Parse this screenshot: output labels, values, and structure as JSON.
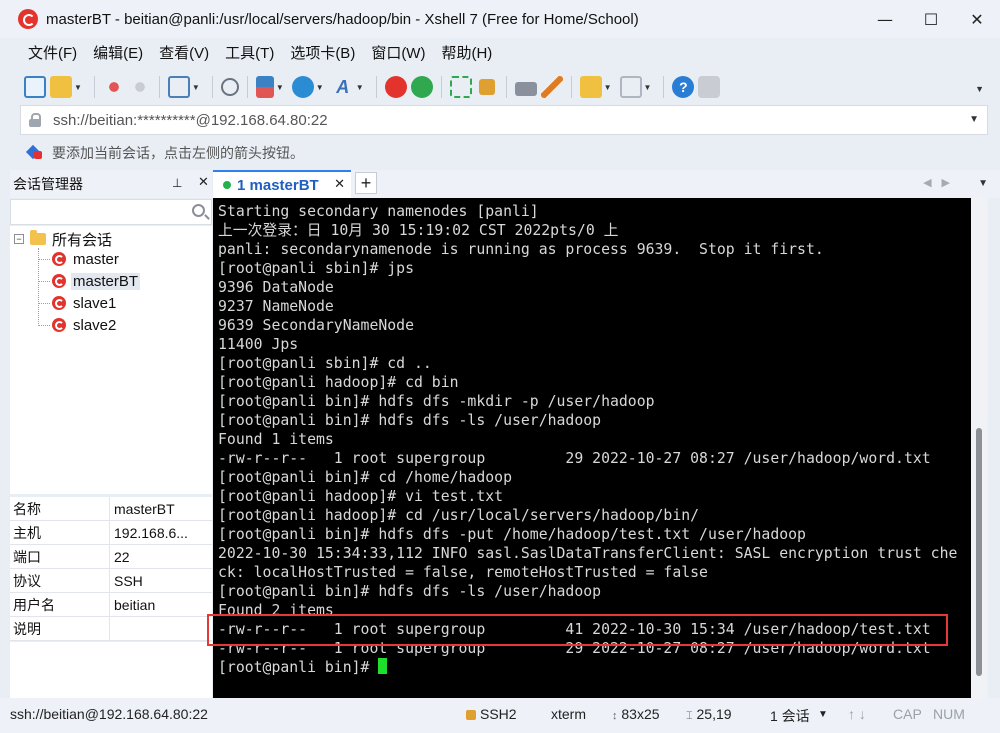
{
  "window": {
    "title": "masterBT - beitian@panli:/usr/local/servers/hadoop/bin - Xshell 7 (Free for Home/School)",
    "minimize": "—",
    "maximize": "☐",
    "close": "✕"
  },
  "menu": [
    "文件(F)",
    "编辑(E)",
    "查看(V)",
    "工具(T)",
    "选项卡(B)",
    "窗口(W)",
    "帮助(H)"
  ],
  "address": {
    "value": "ssh://beitian:**********@192.168.64.80:22"
  },
  "hint": {
    "text": "要添加当前会话，点击左侧的箭头按钮。"
  },
  "session_manager": {
    "title": "会话管理器",
    "pin": "⊥",
    "close": "✕",
    "root_label": "所有会话",
    "toggle": "−",
    "sessions": [
      "master",
      "masterBT",
      "slave1",
      "slave2"
    ],
    "selected": "masterBT"
  },
  "properties": [
    {
      "key": "名称",
      "value": "masterBT"
    },
    {
      "key": "主机",
      "value": "192.168.6..."
    },
    {
      "key": "端口",
      "value": "22"
    },
    {
      "key": "协议",
      "value": "SSH"
    },
    {
      "key": "用户名",
      "value": "beitian"
    },
    {
      "key": "说明",
      "value": ""
    }
  ],
  "tab": {
    "label": "1 masterBT",
    "close": "✕",
    "add": "+"
  },
  "terminal": {
    "lines": [
      "Starting secondary namenodes [panli]",
      "上一次登录：日 10月 30 15:19:02 CST 2022pts/0 上",
      "panli: secondarynamenode is running as process 9639.  Stop it first.",
      "[root@panli sbin]# jps",
      "9396 DataNode",
      "9237 NameNode",
      "9639 SecondaryNameNode",
      "11400 Jps",
      "[root@panli sbin]# cd ..",
      "[root@panli hadoop]# cd bin",
      "[root@panli bin]# hdfs dfs -mkdir -p /user/hadoop",
      "[root@panli bin]# hdfs dfs -ls /user/hadoop",
      "Found 1 items",
      "-rw-r--r--   1 root supergroup         29 2022-10-27 08:27 /user/hadoop/word.txt",
      "[root@panli bin]# cd /home/hadoop",
      "[root@panli hadoop]# vi test.txt",
      "[root@panli hadoop]# cd /usr/local/servers/hadoop/bin/",
      "[root@panli bin]# hdfs dfs -put /home/hadoop/test.txt /user/hadoop",
      "2022-10-30 15:34:33,112 INFO sasl.SaslDataTransferClient: SASL encryption trust che",
      "ck: localHostTrusted = false, remoteHostTrusted = false",
      "[root@panli bin]# hdfs dfs -ls /user/hadoop",
      "Found 2 items",
      "-rw-r--r--   1 root supergroup         41 2022-10-30 15:34 /user/hadoop/test.txt",
      "-rw-r--r--   1 root supergroup         29 2022-10-27 08:27 /user/hadoop/word.txt"
    ],
    "prompt": "[root@panli bin]# "
  },
  "status": {
    "connection": "ssh://beitian@192.168.64.80:22",
    "protocol": "SSH2",
    "term": "xterm",
    "size": "83x25",
    "cursor_pos": "25,19",
    "sessions": "1 会话",
    "caps": "CAP",
    "num": "NUM"
  },
  "colors": {
    "accent": "#2f80ed",
    "cursor": "#1ee02a",
    "highlight": "#e53935",
    "app": "#e2342d"
  }
}
